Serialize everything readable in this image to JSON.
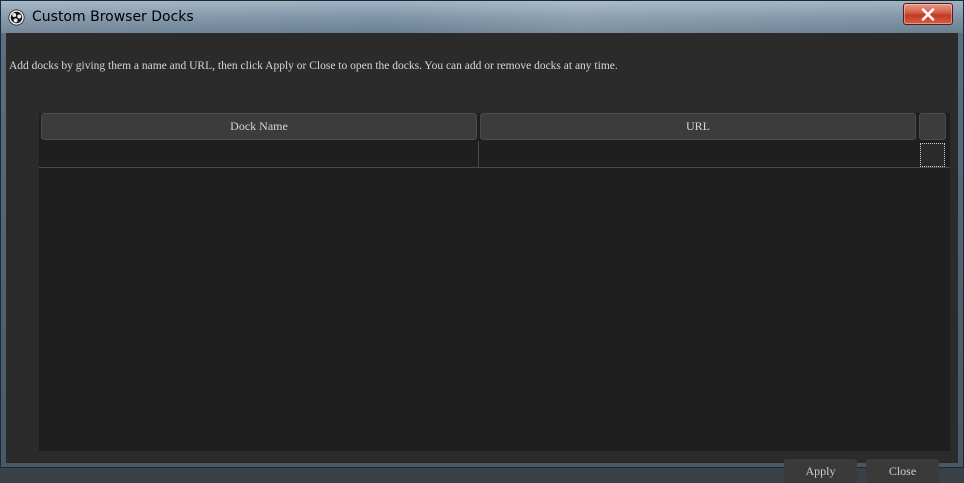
{
  "window": {
    "title": "Custom Browser Docks",
    "app_icon": "obs-logo-icon",
    "close_icon": "close-x-icon"
  },
  "instructions": "Add docks by giving them a name and URL, then click Apply or Close to open the docks. You can add or remove docks at any time.",
  "table": {
    "columns": [
      "Dock Name",
      "URL",
      ""
    ],
    "rows": [
      {
        "dock_name": "",
        "url": ""
      }
    ]
  },
  "buttons": {
    "apply": "Apply",
    "close": "Close"
  },
  "colors": {
    "background": "#2b2b2b",
    "table_background": "#1f1f1f",
    "header_background": "#3c3c3c",
    "text": "#d6d6d6",
    "close_button": "#c23a22"
  }
}
